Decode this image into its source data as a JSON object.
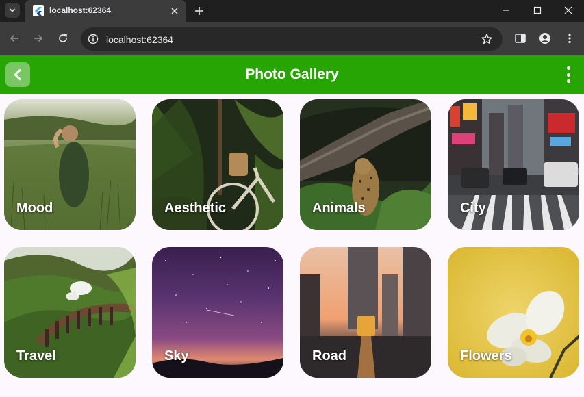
{
  "browser": {
    "tab_title": "localhost:62364",
    "url": "localhost:62364"
  },
  "appbar": {
    "title": "Photo Gallery",
    "color": "#26a504"
  },
  "gallery": {
    "items": [
      {
        "label": "Mood"
      },
      {
        "label": "Aesthetic"
      },
      {
        "label": "Animals"
      },
      {
        "label": "City"
      },
      {
        "label": "Travel"
      },
      {
        "label": "Sky"
      },
      {
        "label": "Road"
      },
      {
        "label": "Flowers"
      }
    ]
  }
}
